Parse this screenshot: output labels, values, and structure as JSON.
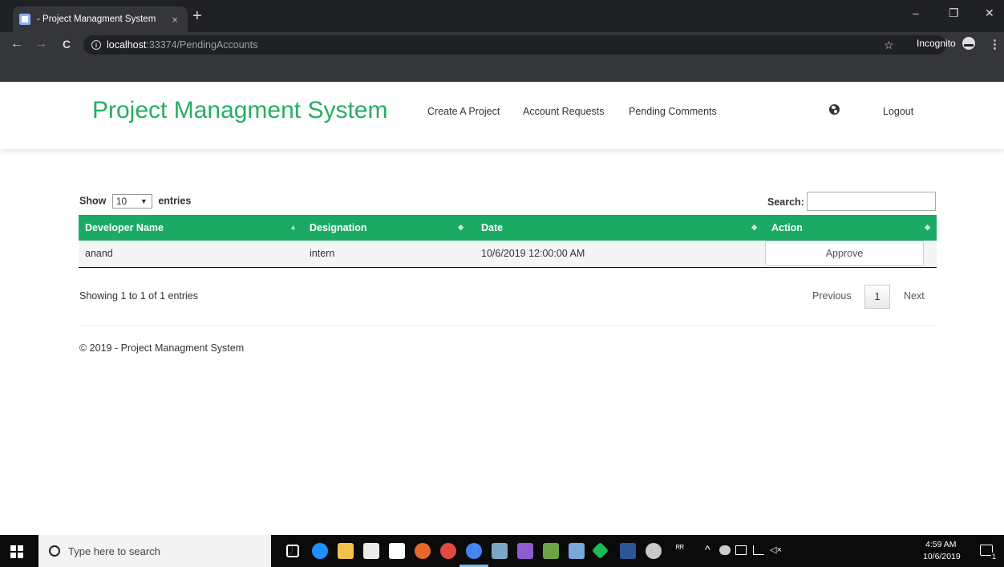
{
  "browser": {
    "tab_title": "- Project Managment System",
    "tab_close": "×",
    "new_tab": "+",
    "minimize": "–",
    "restore": "❐",
    "close": "✕",
    "back": "←",
    "forward": "→",
    "reload": "C",
    "url_host": "localhost",
    "url_path": ":33374/PendingAccounts",
    "info_glyph": "i",
    "star": "☆",
    "incognito_label": "Incognito",
    "menu": "⋮"
  },
  "header": {
    "brand": "Project Managment System",
    "nav": {
      "create_project": "Create A Project",
      "account_requests": "Account Requests",
      "pending_comments": "Pending Comments",
      "logout": "Logout"
    }
  },
  "table_controls": {
    "show_prefix": "Show",
    "page_size": "10",
    "caret": "▼",
    "show_suffix": "entries",
    "search_label": "Search:",
    "search_value": ""
  },
  "table": {
    "columns": [
      "Developer Name",
      "Designation",
      "Date",
      "Action"
    ],
    "sort_glyphs": [
      "▲",
      "◆",
      "◆",
      "◆"
    ],
    "rows": [
      {
        "developer_name": "anand",
        "designation": "intern",
        "date": "10/6/2019 12:00:00 AM",
        "action": "Approve"
      }
    ]
  },
  "pagination": {
    "info": "Showing 1 to 1 of 1 entries",
    "previous": "Previous",
    "current_page": "1",
    "next": "Next"
  },
  "footer": {
    "text": "© 2019 - Project Managment System"
  },
  "taskbar": {
    "search_placeholder": "Type here to search",
    "time": "4:59 AM",
    "date": "10/6/2019",
    "people_glyph": "ᴿᴿ",
    "tray_up": "^",
    "volume": "◁×",
    "notif_count": "1",
    "accent": "#1aaa64"
  }
}
